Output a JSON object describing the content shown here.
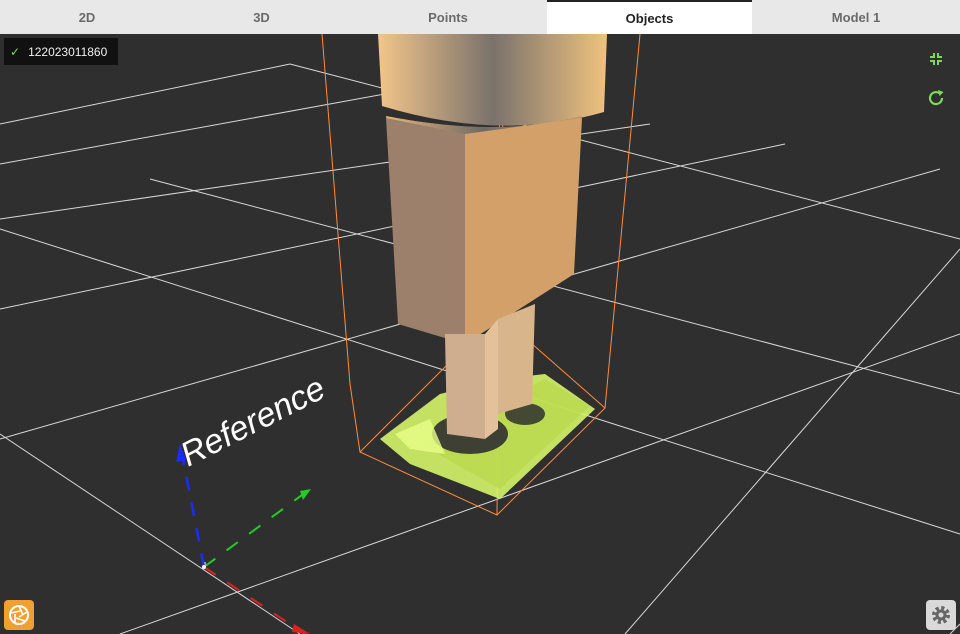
{
  "tabs": [
    {
      "label": "2D"
    },
    {
      "label": "3D"
    },
    {
      "label": "Points"
    },
    {
      "label": "Objects",
      "active": true
    },
    {
      "label": "Model 1"
    }
  ],
  "camera_badge": {
    "serial": "122023011860",
    "status": "connected"
  },
  "scene": {
    "reference_label": "Reference",
    "axis_colors": {
      "x": "#e02020",
      "y": "#22cc22",
      "z": "#1a2cff"
    },
    "bbox_color": "#ff8c3a",
    "pointcloud_color": "#d6f56a",
    "model_color": "#d4a06a",
    "grid_color": "#d8d8d8",
    "background": "#2f2f2f"
  },
  "icons": {
    "collapse": "collapse-icon",
    "refresh": "refresh-icon",
    "capture": "camera-aperture-icon",
    "settings": "gear-icon"
  }
}
